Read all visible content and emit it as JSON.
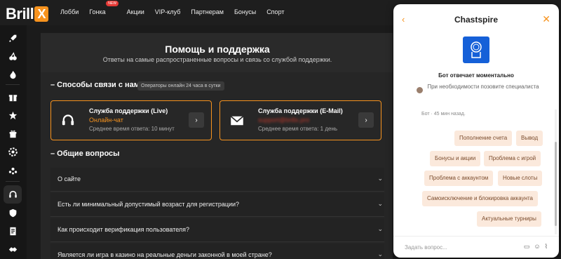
{
  "logo": {
    "text": "Brill",
    "mark": "X"
  },
  "nav": {
    "items": [
      "Лобби",
      "Гонка",
      "Акции",
      "VIP-клуб",
      "Партнерам",
      "Бонусы",
      "Спорт"
    ],
    "new_badge": "NEW"
  },
  "sidebar": {
    "icons": [
      "rocket-icon",
      "cherry-icon",
      "fire-icon",
      "gift-icon",
      "star-icon",
      "gift-box-icon",
      "chip-icon",
      "balloon-icon",
      "headset-icon",
      "shield-icon",
      "document-icon",
      "handshake-icon"
    ]
  },
  "help": {
    "title": "Помощь и поддержка",
    "subtitle": "Ответы на самые распространенные вопросы и связь со службой поддержки.",
    "contacts_title": "– Способы связи с нами",
    "online_badge": "Операторы онлайн 24 часа в сутки",
    "live": {
      "title": "Служба поддержки (Live)",
      "channel": "Онлайн-чат",
      "time": "Среднее время ответа: 10 минут"
    },
    "email": {
      "title": "Служба поддержки (E-Mail)",
      "channel": "support@brillx.pro",
      "time": "Среднее время ответа: 1 день"
    },
    "faq_title": "– Общие вопросы",
    "faq": [
      "О сайте",
      "Есть ли минимальный допустимый возраст для регистрации?",
      "Как происходит верификация пользователя?",
      "Является ли игра в казино на реальные деньги законной в моей стране?"
    ]
  },
  "chat": {
    "title": "Chastspire",
    "bot_status": "Бот отвечает моментально",
    "bot_hint": "При необходимости позовите специалиста",
    "meta": "Бот · 45 мин назад.",
    "chips": [
      "Пополнение счета",
      "Вывод",
      "Бонусы и акции",
      "Проблема с игрой",
      "Проблема с аккаунтом",
      "Новые слоты",
      "Самоисключение и блокировка аккаунта",
      "Актуальные турниры"
    ],
    "input_placeholder": "Задать вопрос..."
  },
  "colors": {
    "accent": "#f7931e",
    "chip_bg": "#fbe9dc",
    "chip_text": "#7a4b2c",
    "bot_logo": "#1560d8"
  }
}
